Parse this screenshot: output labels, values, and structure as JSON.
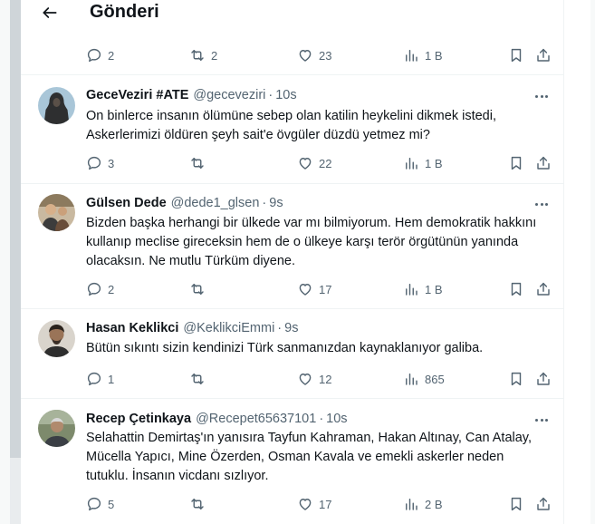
{
  "header": {
    "title": "Gönderi",
    "back_icon": "arrow-left-icon"
  },
  "colors": {
    "text": "#0f1419",
    "secondary": "#536471",
    "divider": "#eff3f4",
    "background": "#ffffff"
  },
  "main_post_actions": {
    "replies": "2",
    "reposts": "2",
    "likes": "23",
    "views": "1 B"
  },
  "replies": [
    {
      "name": "GeceVeziri #ATE",
      "handle": "@geceveziri",
      "separator": "·",
      "time": "10s",
      "text": "On binlerce insanın ölümüne sebep olan katilin heykelini dikmek istedi, Askerlerimizi öldüren şeyh sait'e övgüler düzdü yetmez mi?",
      "replies": "3",
      "reposts": "",
      "likes": "22",
      "views": "1 B"
    },
    {
      "name": "Gülsen Dede",
      "handle": "@dede1_glsen",
      "separator": "·",
      "time": "9s",
      "text": "Bizden başka herhangi bir ülkede var mı bilmiyorum. Hem demokratik hakkını kullanıp meclise gireceksin hem de o ülkeye karşı terör örgütünün yanında olacaksın. Ne mutlu Türküm diyene.",
      "replies": "2",
      "reposts": "",
      "likes": "17",
      "views": "1 B"
    },
    {
      "name": "Hasan Keklikci",
      "handle": "@KeklikciEmmi",
      "separator": "·",
      "time": "9s",
      "text": "Bütün sıkıntı sizin kendinizi Türk sanmanızdan kaynaklanıyor galiba.",
      "replies": "1",
      "reposts": "",
      "likes": "12",
      "views": "865"
    },
    {
      "name": "Recep Çetinkaya",
      "handle": "@Recepet65637101",
      "separator": "·",
      "time": "10s",
      "text": "Selahattin Demirtaş'ın yanısıra Tayfun Kahraman, Hakan Altınay, Can Atalay, Mücella Yapıcı, Mine Özerden, Osman Kavala ve emekli askerler neden tutuklu. İnsanın vicdanı sızlıyor.",
      "replies": "5",
      "reposts": "",
      "likes": "17",
      "views": "2 B"
    }
  ]
}
